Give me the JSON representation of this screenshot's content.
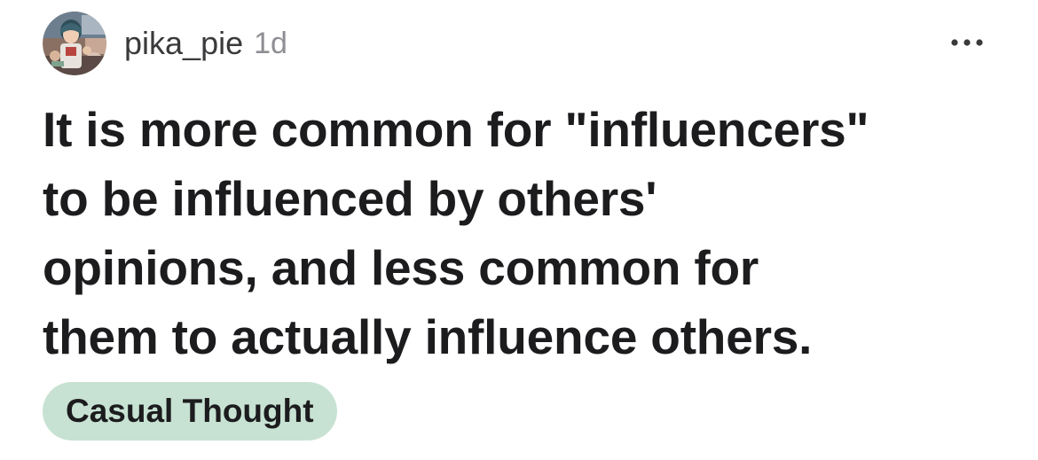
{
  "post": {
    "author": "pika_pie",
    "age": "1d",
    "title_lines": [
      "It is more common for \"influencers\"",
      "to be influenced by others'",
      "opinions, and less common for",
      "them to actually influence others."
    ],
    "flair": "Casual Thought",
    "flair_color": "#c7e2d2"
  },
  "icons": {
    "avatar": "user-avatar-icon",
    "more": "more-options-icon"
  }
}
